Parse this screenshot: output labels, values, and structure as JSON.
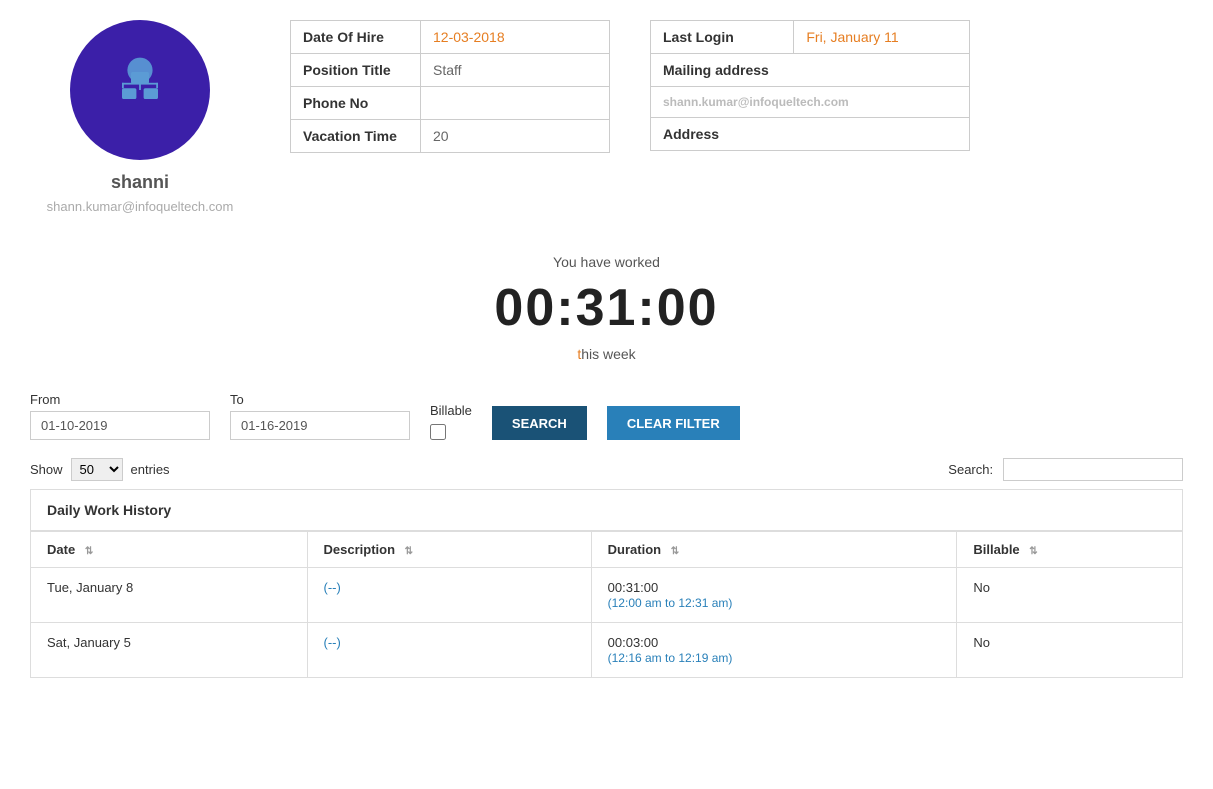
{
  "profile": {
    "name": "shanni",
    "email": "shann.kumar@infoqueltech.com"
  },
  "info_table": {
    "rows": [
      {
        "label": "Date Of Hire",
        "value": "12-03-2018",
        "highlight": true
      },
      {
        "label": "Position Title",
        "value": "Staff",
        "highlight": false
      },
      {
        "label": "Phone No",
        "value": "",
        "highlight": false
      },
      {
        "label": "Vacation Time",
        "value": "20",
        "highlight": false
      }
    ]
  },
  "right_info": {
    "last_login_label": "Last Login",
    "last_login_value": "Fri, January 11",
    "mailing_label": "Mailing address",
    "mailing_value": "shann.kumar@infoqueltech.com",
    "address_label": "Address",
    "address_value": ""
  },
  "worked": {
    "label": "You have worked",
    "time": "00:31:00",
    "week_prefix": "",
    "week_highlight": "t",
    "week_suffix": "his week"
  },
  "filter": {
    "from_label": "From",
    "from_value": "01-10-2019",
    "to_label": "To",
    "to_value": "01-16-2019",
    "billable_label": "Billable",
    "search_btn": "SEARCH",
    "clear_btn": "CLEAR FILTER"
  },
  "table_controls": {
    "show_label": "Show",
    "entries_value": "50",
    "entries_label": "entries",
    "search_label": "Search:"
  },
  "table": {
    "section_title": "Daily Work History",
    "columns": [
      {
        "label": "Date"
      },
      {
        "label": "Description"
      },
      {
        "label": "Duration"
      },
      {
        "label": "Billable"
      }
    ],
    "rows": [
      {
        "date": "Tue, January 8",
        "description": "(--)",
        "duration": "00:31:00",
        "duration_detail": "(12:00 am to 12:31 am)",
        "billable": "No"
      },
      {
        "date": "Sat, January 5",
        "description": "(--)",
        "duration": "00:03:00",
        "duration_detail": "(12:16 am to 12:19 am)",
        "billable": "No"
      }
    ]
  },
  "colors": {
    "avatar_bg": "#3b1fa8",
    "accent": "#e67e22",
    "btn_dark": "#1a5276",
    "btn_blue": "#2980b9",
    "link": "#2980b9"
  }
}
